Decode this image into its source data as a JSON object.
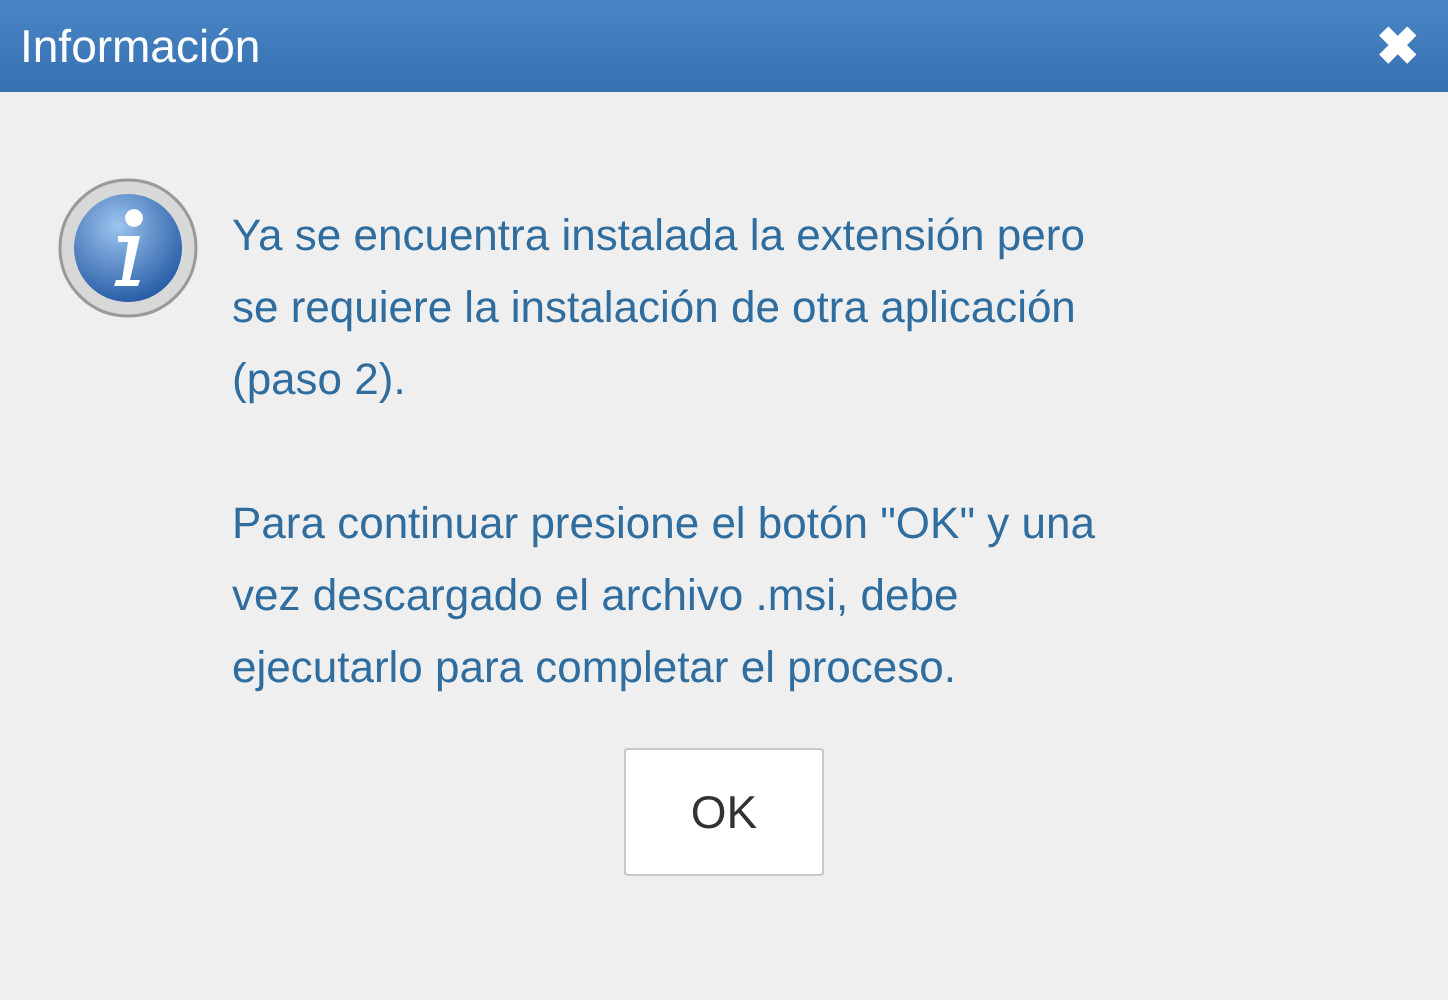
{
  "dialog": {
    "title": "Información",
    "close": "✖",
    "paragraphs": [
      "Ya se encuentra instalada la extensión pero\nse requiere la instalación de otra aplicación\n(paso 2).",
      "Para continuar presione el botón \"OK\" y una\nvez descargado el archivo .msi, debe\nejecutarlo para completar el proceso."
    ],
    "buttons": [
      "OK"
    ]
  }
}
